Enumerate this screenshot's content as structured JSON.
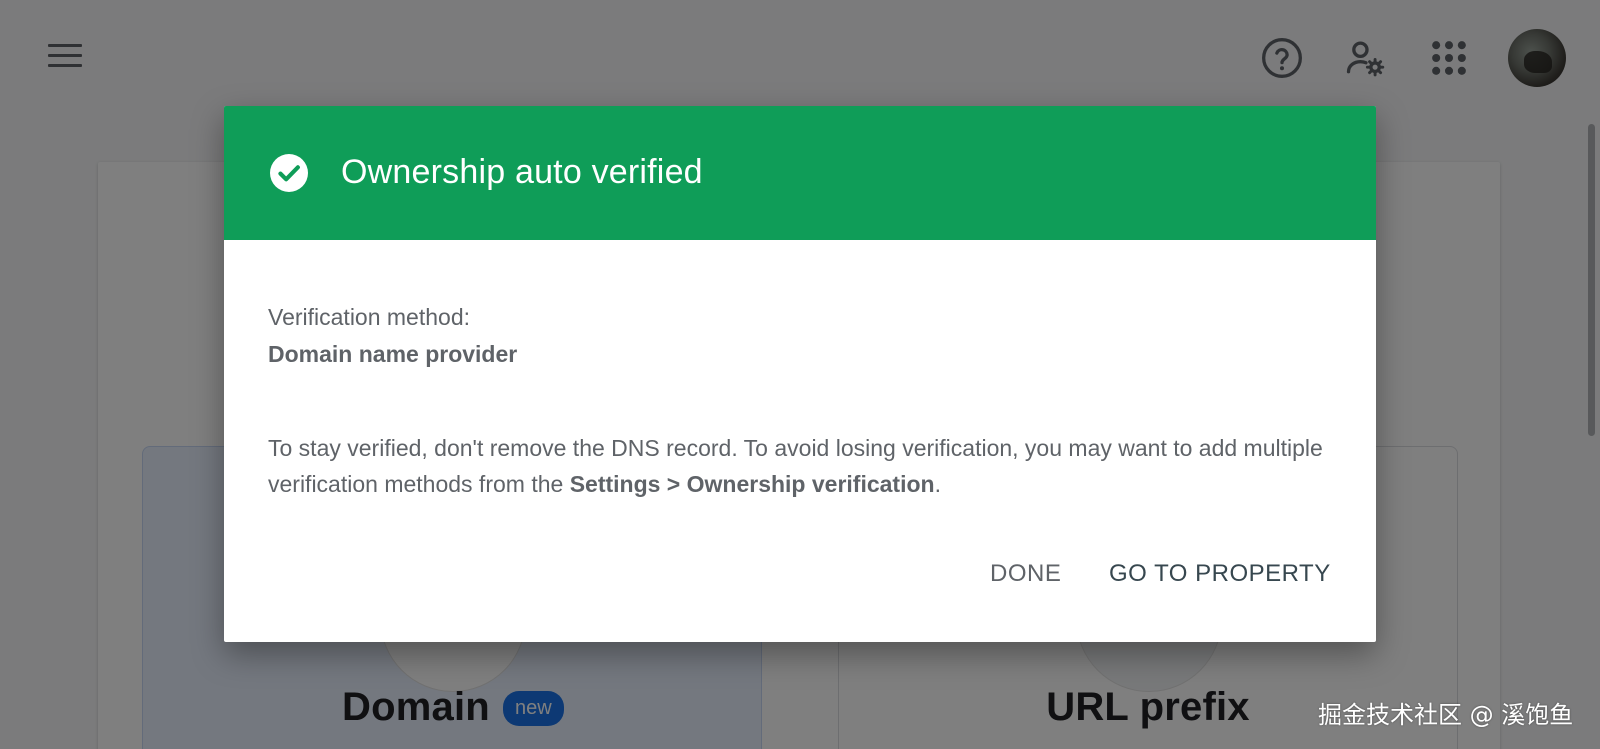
{
  "header": {
    "menu_icon": "hamburger-menu-icon",
    "help_icon": "help-circle-icon",
    "admin_icon": "user-settings-icon",
    "apps_icon": "apps-grid-icon",
    "avatar": "user-avatar"
  },
  "background": {
    "domain_title": "Domain",
    "domain_badge": "new",
    "url_title": "URL prefix"
  },
  "dialog": {
    "header_color": "#0f9d58",
    "check_icon": "check-circle-icon",
    "title": "Ownership auto verified",
    "method_label": "Verification method:",
    "method_value": "Domain name provider",
    "body_pre": "To stay verified, don't remove the DNS record. To avoid losing verification, you may want to add multiple verification methods from the ",
    "body_link": "Settings > Ownership verification",
    "body_post": ".",
    "done_label": "DONE",
    "go_label": "GO TO PROPERTY"
  },
  "watermark": "掘金技术社区 @ 溪饱鱼"
}
